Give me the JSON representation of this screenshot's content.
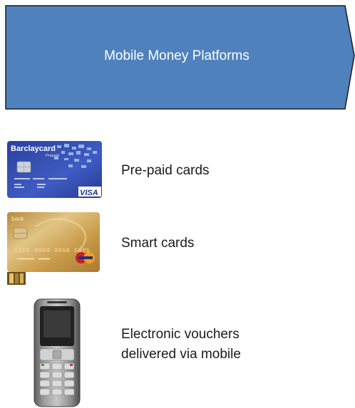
{
  "banner": {
    "title": "Mobile Money Platforms",
    "fill": "#4f81bd",
    "stroke": "#1c1c1c"
  },
  "items": [
    {
      "label": "Pre-paid cards",
      "image": "barclaycard-prepaid-visa-card",
      "card_brand": "Barclaycard",
      "card_subtitle": "Prepaid",
      "network": "VISA"
    },
    {
      "label": "Smart cards",
      "image": "gold-chip-smart-card",
      "card_brand": "bank",
      "card_number": "5355 0000 3050 5505"
    },
    {
      "label_lines": [
        "Electronic vouchers",
        "delivered via mobile"
      ],
      "image": "mobile-phone"
    }
  ]
}
